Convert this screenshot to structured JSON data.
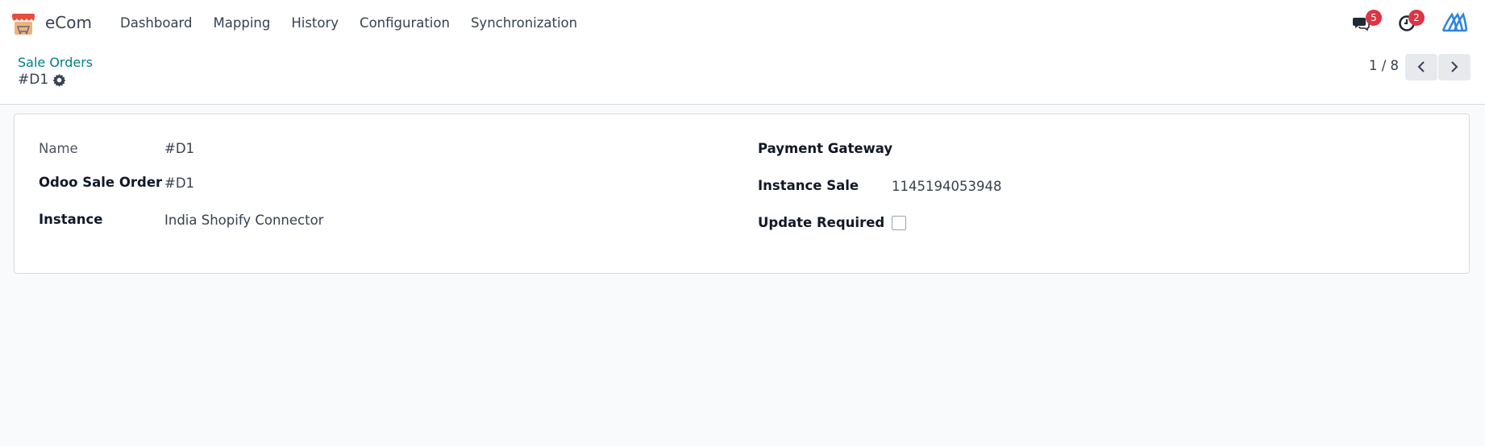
{
  "navbar": {
    "app_name": "eCom",
    "menu": [
      "Dashboard",
      "Mapping",
      "History",
      "Configuration",
      "Synchronization"
    ],
    "messages_count": "5",
    "activities_count": "2"
  },
  "control_panel": {
    "breadcrumb": "Sale Orders",
    "record_title": "#D1",
    "pager": "1 / 8"
  },
  "form": {
    "name_label": "Name",
    "name_value": "#D1",
    "odoo_sale_order_label": "Odoo Sale Order",
    "odoo_sale_order_value": "#D1",
    "instance_label": "Instance",
    "instance_value": "India Shopify Connector",
    "payment_gateway_label": "Payment Gateway",
    "payment_gateway_value": "",
    "instance_sale_label": "Instance Sale",
    "instance_sale_value": "1145194053948",
    "update_required_label": "Update Required",
    "update_required_value": false
  },
  "colors": {
    "accent": "#017e84",
    "badge": "#dc3545",
    "brand_logo": "#2e86de"
  }
}
